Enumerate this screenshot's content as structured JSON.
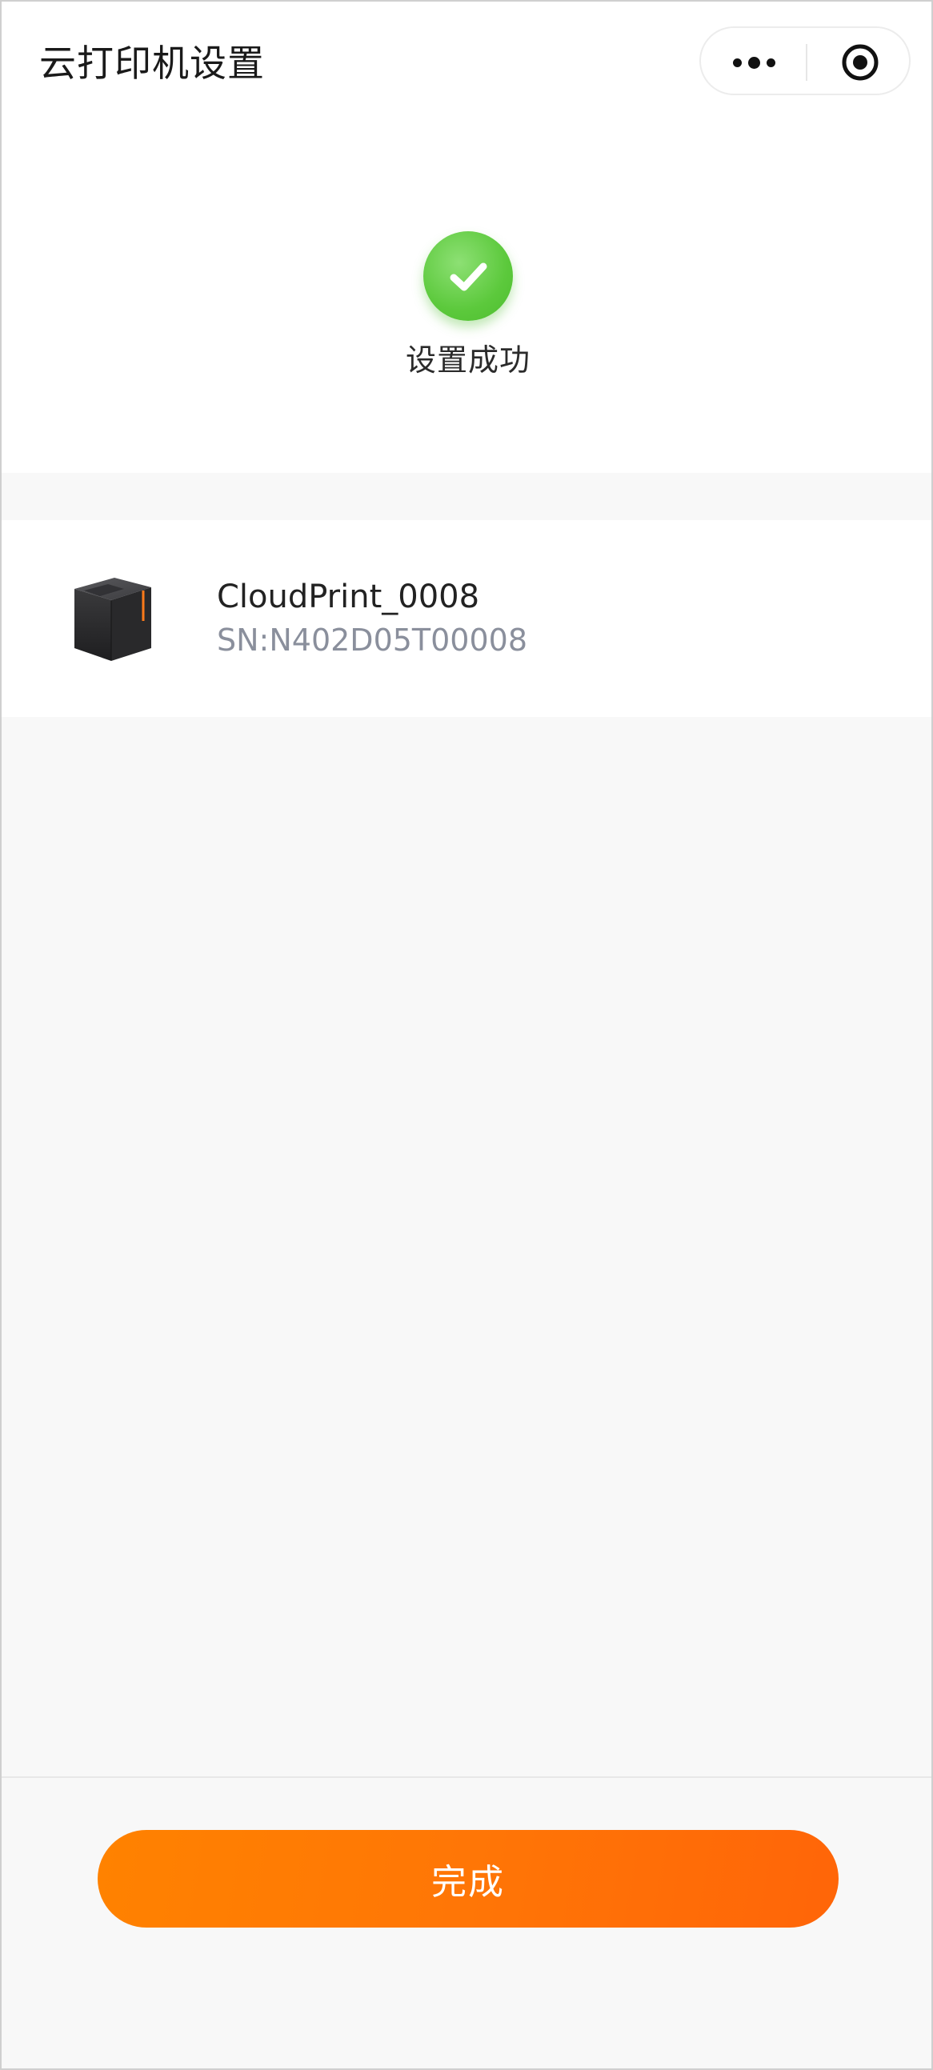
{
  "header": {
    "title": "云打印机设置",
    "icons": [
      "more-dots-icon",
      "target-circle-icon"
    ]
  },
  "status": {
    "icon": "check-circle-icon",
    "text": "设置成功",
    "color": "#5cc93c"
  },
  "device": {
    "image": "printer-image",
    "name": "CloudPrint_0008",
    "sn": "SN:N402D05T00008"
  },
  "footer": {
    "done_label": "完成",
    "accent": "#ff7a00"
  }
}
